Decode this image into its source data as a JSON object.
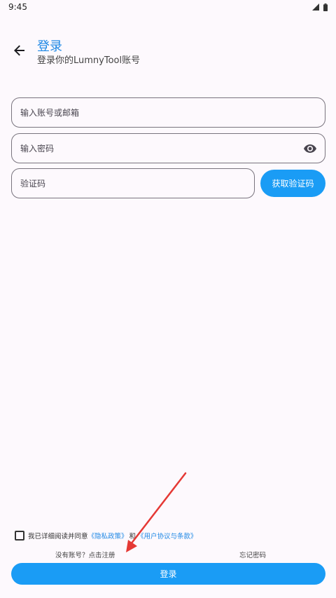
{
  "status_bar": {
    "time": "9:45",
    "icons": [
      "signal-icon",
      "battery-icon"
    ]
  },
  "header": {
    "back_icon": "arrow-left-icon",
    "title": "登录",
    "subtitle": "登录你的LumnyTool账号"
  },
  "form": {
    "account_placeholder": "输入账号或邮箱",
    "password_placeholder": "输入密码",
    "password_toggle_icon": "eye-icon",
    "code_placeholder": "验证码",
    "get_code_label": "获取验证码"
  },
  "agreement": {
    "checked": false,
    "prefix": "我已详细阅读并同意",
    "privacy_link": "《隐私政策》",
    "and_text": "和",
    "terms_link": "《用户协议与条款》"
  },
  "links": {
    "register": "没有账号？点击注册",
    "forgot": "忘记密码"
  },
  "login_label": "登录",
  "colors": {
    "accent": "#1a9cf5",
    "title_blue": "#1e88e5",
    "annotation_red": "#e53935",
    "background": "#fdf9fd"
  }
}
